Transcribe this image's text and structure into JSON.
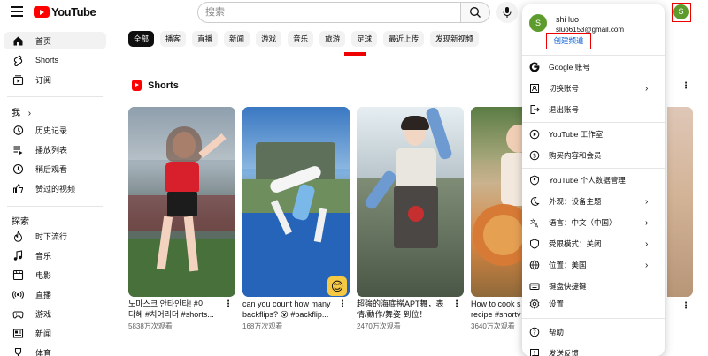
{
  "header": {
    "logo_text": "YouTube",
    "search_placeholder": "搜索"
  },
  "account": {
    "avatar_letter": "S",
    "name": "shi luo",
    "email": "sluo6153@gmail.com",
    "create_channel": "创建频道"
  },
  "sidebar": {
    "main": [
      {
        "label": "首页",
        "icon": "home-icon"
      },
      {
        "label": "Shorts",
        "icon": "shorts-icon"
      },
      {
        "label": "订阅",
        "icon": "subscriptions-icon"
      }
    ],
    "you_header": "我",
    "you": [
      {
        "label": "历史记录",
        "icon": "history-icon"
      },
      {
        "label": "播放列表",
        "icon": "playlist-icon"
      },
      {
        "label": "稍后观看",
        "icon": "watch-later-icon"
      },
      {
        "label": "赞过的视频",
        "icon": "thumbs-up-icon"
      }
    ],
    "explore_header": "探索",
    "explore": [
      {
        "label": "时下流行",
        "icon": "trending-icon"
      },
      {
        "label": "音乐",
        "icon": "music-icon"
      },
      {
        "label": "电影",
        "icon": "movies-icon"
      },
      {
        "label": "直播",
        "icon": "live-icon"
      },
      {
        "label": "游戏",
        "icon": "gaming-icon"
      },
      {
        "label": "新闻",
        "icon": "news-icon"
      },
      {
        "label": "体育",
        "icon": "sports-icon"
      }
    ]
  },
  "chips": [
    "全部",
    "播客",
    "直播",
    "新闻",
    "游戏",
    "音乐",
    "旅游",
    "足球",
    "最近上传",
    "发现新视频"
  ],
  "shorts": {
    "title": "Shorts",
    "items": [
      {
        "title_line1": "노마스크 안타안타! #이",
        "title_line2": "다혜 #치어리더 #shorts...",
        "views": "5838万次观看"
      },
      {
        "title_line1": "can you count how many",
        "title_line2": "backflips? 😮 #backflip...",
        "views": "168万次观看"
      },
      {
        "title_line1": "超強的海底撈APT舞，表",
        "title_line2": "情/動作/舞姿 到位！",
        "views": "2470万次观看"
      },
      {
        "title_line1": "How to cook s",
        "title_line2": "recipe #shortv",
        "views": "3640万次观看"
      }
    ]
  },
  "menu": {
    "items": [
      {
        "label": "Google 账号",
        "icon": "google-icon",
        "chevron": false
      },
      {
        "label": "切换账号",
        "icon": "switch-account-icon",
        "chevron": true
      },
      {
        "label": "退出账号",
        "icon": "sign-out-icon",
        "chevron": false
      },
      {
        "label": "YouTube 工作室",
        "icon": "studio-icon",
        "chevron": false
      },
      {
        "label": "购买内容和会员",
        "icon": "purchases-icon",
        "chevron": false
      },
      {
        "label": "YouTube 个人数据管理",
        "icon": "your-data-icon",
        "chevron": false
      },
      {
        "label": "外观：设备主题",
        "icon": "appearance-icon",
        "chevron": true
      },
      {
        "label": "语言：中文（中国）",
        "icon": "language-icon",
        "chevron": true
      },
      {
        "label": "受限模式：关闭",
        "icon": "restricted-mode-icon",
        "chevron": true
      },
      {
        "label": "位置：美国",
        "icon": "location-icon",
        "chevron": true
      },
      {
        "label": "键盘快捷键",
        "icon": "keyboard-icon",
        "chevron": false
      },
      {
        "label": "设置",
        "icon": "settings-icon",
        "chevron": false
      },
      {
        "label": "帮助",
        "icon": "help-icon",
        "chevron": false
      },
      {
        "label": "发送反馈",
        "icon": "feedback-icon",
        "chevron": false
      }
    ]
  },
  "colors": {
    "brand_red": "#ff0000",
    "highlight_border": "#e00000",
    "link_blue": "#065fd4",
    "avatar_green": "#5d9c2c"
  }
}
